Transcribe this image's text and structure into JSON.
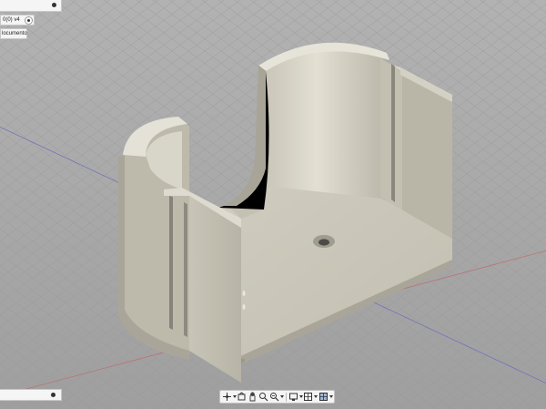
{
  "document": {
    "tab_label": "0(0) v4",
    "note_label": "locumento"
  },
  "toolbar": {
    "tools": [
      {
        "icon": "orbit-icon",
        "label": ""
      },
      {
        "icon": "look-at-icon",
        "label": ""
      },
      {
        "icon": "pan-hand-icon",
        "label": ""
      },
      {
        "icon": "zoom-icon",
        "label": ""
      },
      {
        "icon": "zoom-window-icon",
        "label": ""
      },
      {
        "icon": "display-settings-icon",
        "label": ""
      },
      {
        "icon": "grid-icon",
        "label": ""
      },
      {
        "icon": "viewports-icon",
        "label": ""
      }
    ]
  },
  "colors": {
    "viewport_bg": "#a7a7a7",
    "grid_line": "#9b9b9b",
    "axis_red": "#c06a6a",
    "axis_blue": "#6a6ac0",
    "model_light": "#d6d3c6",
    "model_mid": "#bfbcae",
    "model_dark": "#8f8c80"
  }
}
